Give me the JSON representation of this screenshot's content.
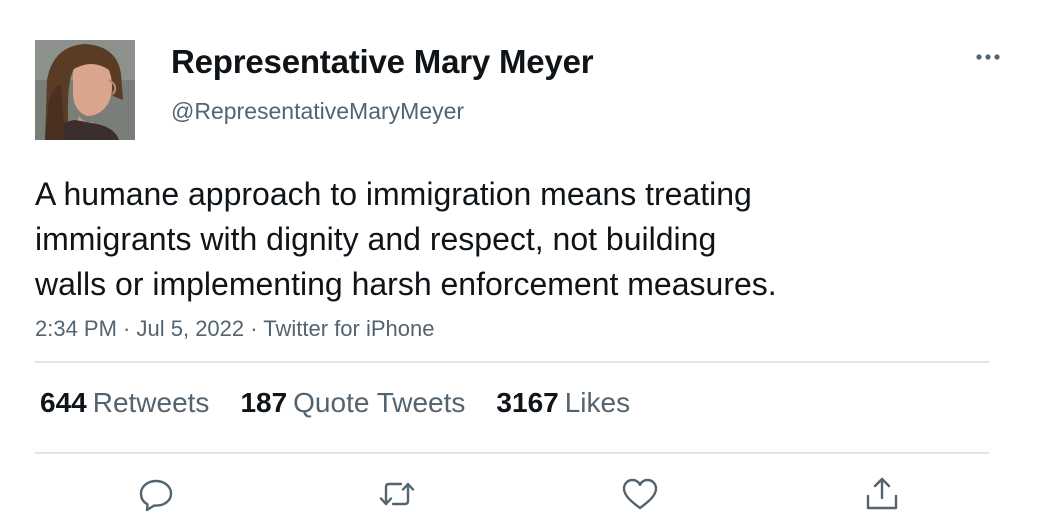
{
  "tweet": {
    "author": {
      "display_name": "Representative Mary Meyer",
      "handle": "@RepresentativeMaryMeyer"
    },
    "text_lines": [
      "A humane approach to immigration means treating",
      "immigrants with dignity and respect, not building",
      "walls or implementing harsh enforcement measures."
    ],
    "time": "2:34 PM",
    "date": "Jul 5, 2022",
    "source": "Twitter for iPhone",
    "separator": " · "
  },
  "stats": {
    "retweets_count": "644",
    "retweets_label": "Retweets",
    "quote_tweets_count": "187",
    "quote_tweets_label": "Quote Tweets",
    "likes_count": "3167",
    "likes_label": "Likes"
  },
  "actions": [
    "reply-icon",
    "retweet-icon",
    "like-icon",
    "share-icon"
  ],
  "colors": {
    "text_primary": "#0f1419",
    "text_secondary": "#536471",
    "divider": "#e1e5e8",
    "icon": "#536471"
  }
}
